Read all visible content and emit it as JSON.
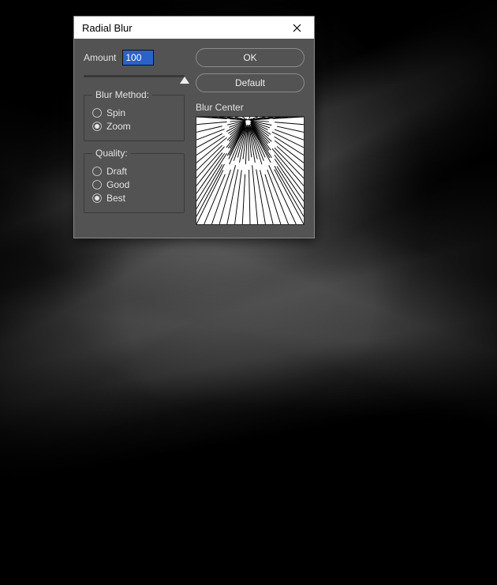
{
  "dialog": {
    "title": "Radial Blur",
    "amount_label": "Amount",
    "amount_value": "100",
    "slider_position_percent": 100,
    "method_legend": "Blur Method:",
    "method_options": {
      "spin": "Spin",
      "zoom": "Zoom"
    },
    "method_selected": "zoom",
    "quality_legend": "Quality:",
    "quality_options": {
      "draft": "Draft",
      "good": "Good",
      "best": "Best"
    },
    "quality_selected": "best",
    "ok_label": "OK",
    "default_label": "Default",
    "preview_label": "Blur Center",
    "preview_center": {
      "x_percent": 48,
      "y_percent": 3
    }
  },
  "colors": {
    "dialog_bg": "#535353",
    "titlebar_bg": "#ffffff",
    "text": "#e3e3e3",
    "selection_bg": "#2a62c7"
  },
  "chart_data": {
    "type": "line",
    "title": "Blur Center preview",
    "xlabel": "",
    "ylabel": "",
    "xlim": [
      0,
      100
    ],
    "ylim": [
      0,
      100
    ],
    "origin": {
      "x": 48,
      "y": 3
    },
    "series": [
      {
        "name": "rays",
        "values_note": "radial rays emanating from origin toward full extent"
      }
    ]
  }
}
